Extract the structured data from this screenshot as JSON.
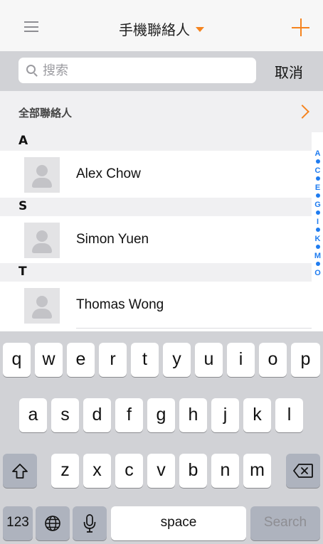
{
  "nav": {
    "title": "手機聯絡人"
  },
  "search": {
    "placeholder": "搜索",
    "cancel_label": "取消"
  },
  "all_contacts": {
    "label": "全部聯絡人"
  },
  "sections": [
    {
      "letter": "A",
      "contacts": [
        {
          "name": "Alex Chow"
        }
      ]
    },
    {
      "letter": "S",
      "contacts": [
        {
          "name": "Simon Yuen"
        }
      ]
    },
    {
      "letter": "T",
      "contacts": [
        {
          "name": "Thomas Wong"
        }
      ]
    }
  ],
  "index": [
    "A",
    "C",
    "E",
    "G",
    "I",
    "K",
    "M",
    "O"
  ],
  "keyboard": {
    "row1": [
      "q",
      "w",
      "e",
      "r",
      "t",
      "y",
      "u",
      "i",
      "o",
      "p"
    ],
    "row2": [
      "a",
      "s",
      "d",
      "f",
      "g",
      "h",
      "j",
      "k",
      "l"
    ],
    "row3": [
      "z",
      "x",
      "c",
      "v",
      "b",
      "n",
      "m"
    ],
    "numbers_label": "123",
    "space_label": "space",
    "search_label": "Search"
  },
  "colors": {
    "accent": "#f5841f",
    "index": "#1f7cf0",
    "keyboard_bg": "#d1d2d6"
  },
  "icons": [
    "menu-icon",
    "caret-down-icon",
    "plus-icon",
    "search-icon",
    "chevron-right-icon",
    "avatar-placeholder-icon",
    "shift-icon",
    "backspace-icon",
    "globe-icon",
    "microphone-icon"
  ]
}
